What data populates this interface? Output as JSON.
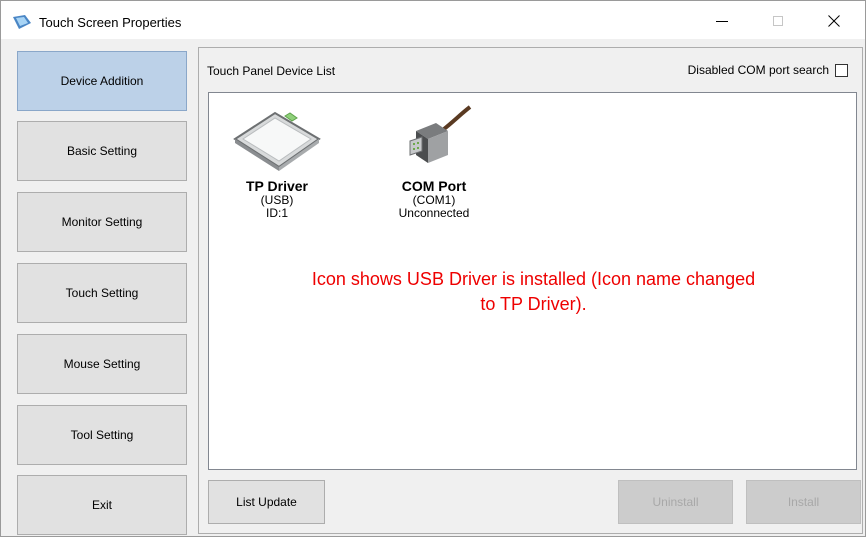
{
  "window": {
    "title": "Touch Screen Properties",
    "icon": "touch-screen-app-icon"
  },
  "sidebar": {
    "items": [
      {
        "label": "Device Addition",
        "active": true
      },
      {
        "label": "Basic Setting",
        "active": false
      },
      {
        "label": "Monitor Setting",
        "active": false
      },
      {
        "label": "Touch Setting",
        "active": false
      },
      {
        "label": "Mouse Setting",
        "active": false
      },
      {
        "label": "Tool Setting",
        "active": false
      },
      {
        "label": "Exit",
        "active": false
      }
    ]
  },
  "main": {
    "title": "Touch Panel Device List",
    "com_search_label": "Disabled COM port search",
    "com_search_checked": false,
    "devices": [
      {
        "name": "TP Driver",
        "line1": "(USB)",
        "line2": "ID:1",
        "icon": "touch-panel-icon"
      },
      {
        "name": "COM Port",
        "line1": "(COM1)",
        "line2": "Unconnected",
        "icon": "serial-connector-icon"
      }
    ],
    "annotation_line1": "Icon shows USB Driver is installed (Icon name changed",
    "annotation_line2": "to TP Driver).",
    "annotation_color": "#ee0000"
  },
  "footer": {
    "list_update_label": "List Update",
    "uninstall_label": "Uninstall",
    "install_label": "Install"
  }
}
